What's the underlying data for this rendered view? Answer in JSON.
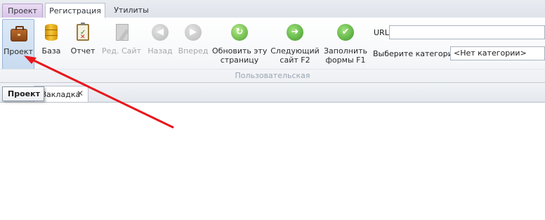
{
  "ribbon_tabs": {
    "app": "Проект",
    "active": "Регистрация",
    "third": "Утилиты"
  },
  "toolbar": {
    "project": "Проект",
    "base": "База",
    "report": "Отчет",
    "edit_site": "Ред. Сайт",
    "back": "Назад",
    "forward": "Вперед",
    "refresh_line1": "Обновить эту",
    "refresh_line2": "страницу",
    "next_line1": "Следующий",
    "next_line2": "сайт F2",
    "fill_line1": "Заполнить",
    "fill_line2": "формы F1"
  },
  "fields": {
    "url_label": "URL",
    "url_value": "",
    "category_label": "Выберите категории",
    "category_value": "<Нет категории>"
  },
  "group_label": "Пользовательская",
  "document_tab": {
    "label": "Закладка",
    "close_glyph": "✕"
  },
  "tooltip": "Проект",
  "colors": {
    "annotation_arrow": "#e8161b",
    "ribbon_accent": "#b8a0cc",
    "selected_button": "#c8dbf0"
  },
  "icons": {
    "project": "briefcase-icon",
    "base": "database-icon",
    "report": "clipboard-report-icon",
    "edit_site": "edit-document-icon",
    "back": "arrow-left-icon",
    "forward": "arrow-right-icon",
    "refresh": "refresh-icon",
    "next": "next-arrow-icon",
    "fill": "checkmark-icon"
  }
}
